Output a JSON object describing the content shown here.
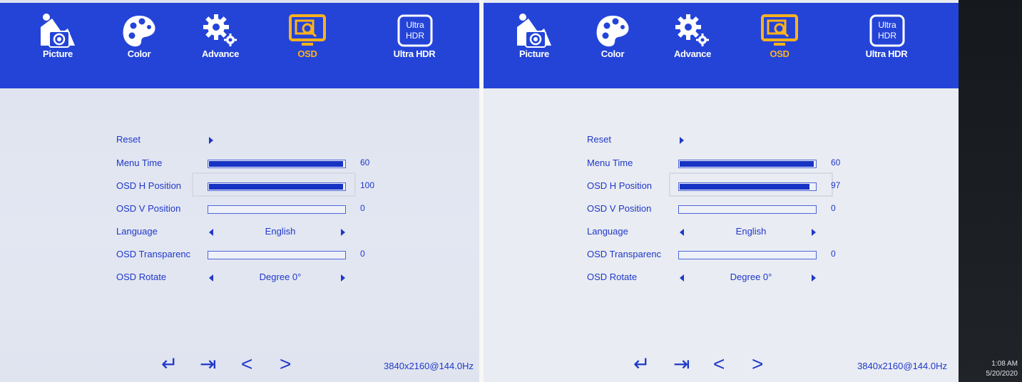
{
  "tabs": [
    {
      "label": "Picture",
      "icon": "picture-icon"
    },
    {
      "label": "Color",
      "icon": "palette-icon"
    },
    {
      "label": "Advance",
      "icon": "gear-icon"
    },
    {
      "label": "OSD",
      "icon": "osd-monitor-icon",
      "active": true
    },
    {
      "label": "Ultra HDR",
      "icon": "ultra-hdr-icon",
      "badge": "Ultra\nHDR"
    }
  ],
  "left": {
    "reset": "Reset",
    "menu_time": {
      "label": "Menu Time",
      "value": "60",
      "level": 1.0
    },
    "osd_h": {
      "label": "OSD H Position",
      "value": "100",
      "level": 1.0
    },
    "osd_v": {
      "label": "OSD V Position",
      "value": "0",
      "level": 0.0
    },
    "language": {
      "label": "Language",
      "value": "English"
    },
    "transparency": {
      "label": "OSD Transparenc",
      "value": "0",
      "level": 0.0
    },
    "rotate": {
      "label": "OSD Rotate",
      "value": "Degree 0°"
    },
    "resolution": "3840x2160@144.0Hz"
  },
  "right": {
    "reset": "Reset",
    "menu_time": {
      "label": "Menu Time",
      "value": "60",
      "level": 1.0
    },
    "osd_h": {
      "label": "OSD H Position",
      "value": "97",
      "level": 0.97
    },
    "osd_v": {
      "label": "OSD V Position",
      "value": "0",
      "level": 0.0
    },
    "language": {
      "label": "Language",
      "value": "English"
    },
    "transparency": {
      "label": "OSD Transparenc",
      "value": "0",
      "level": 0.0
    },
    "rotate": {
      "label": "OSD Rotate",
      "value": "Degree 0°"
    },
    "resolution": "3840x2160@144.0Hz"
  },
  "nav_glyphs": {
    "enter": "↵",
    "exit": "⇥",
    "prev": "<",
    "next": ">"
  },
  "taskbar": {
    "time": "1:08 AM",
    "date": "5/20/2020"
  },
  "colors": {
    "accent": "#2444d8",
    "text": "#1f38c9",
    "active": "#ffb21c",
    "bar_fill": "#1733c4"
  }
}
